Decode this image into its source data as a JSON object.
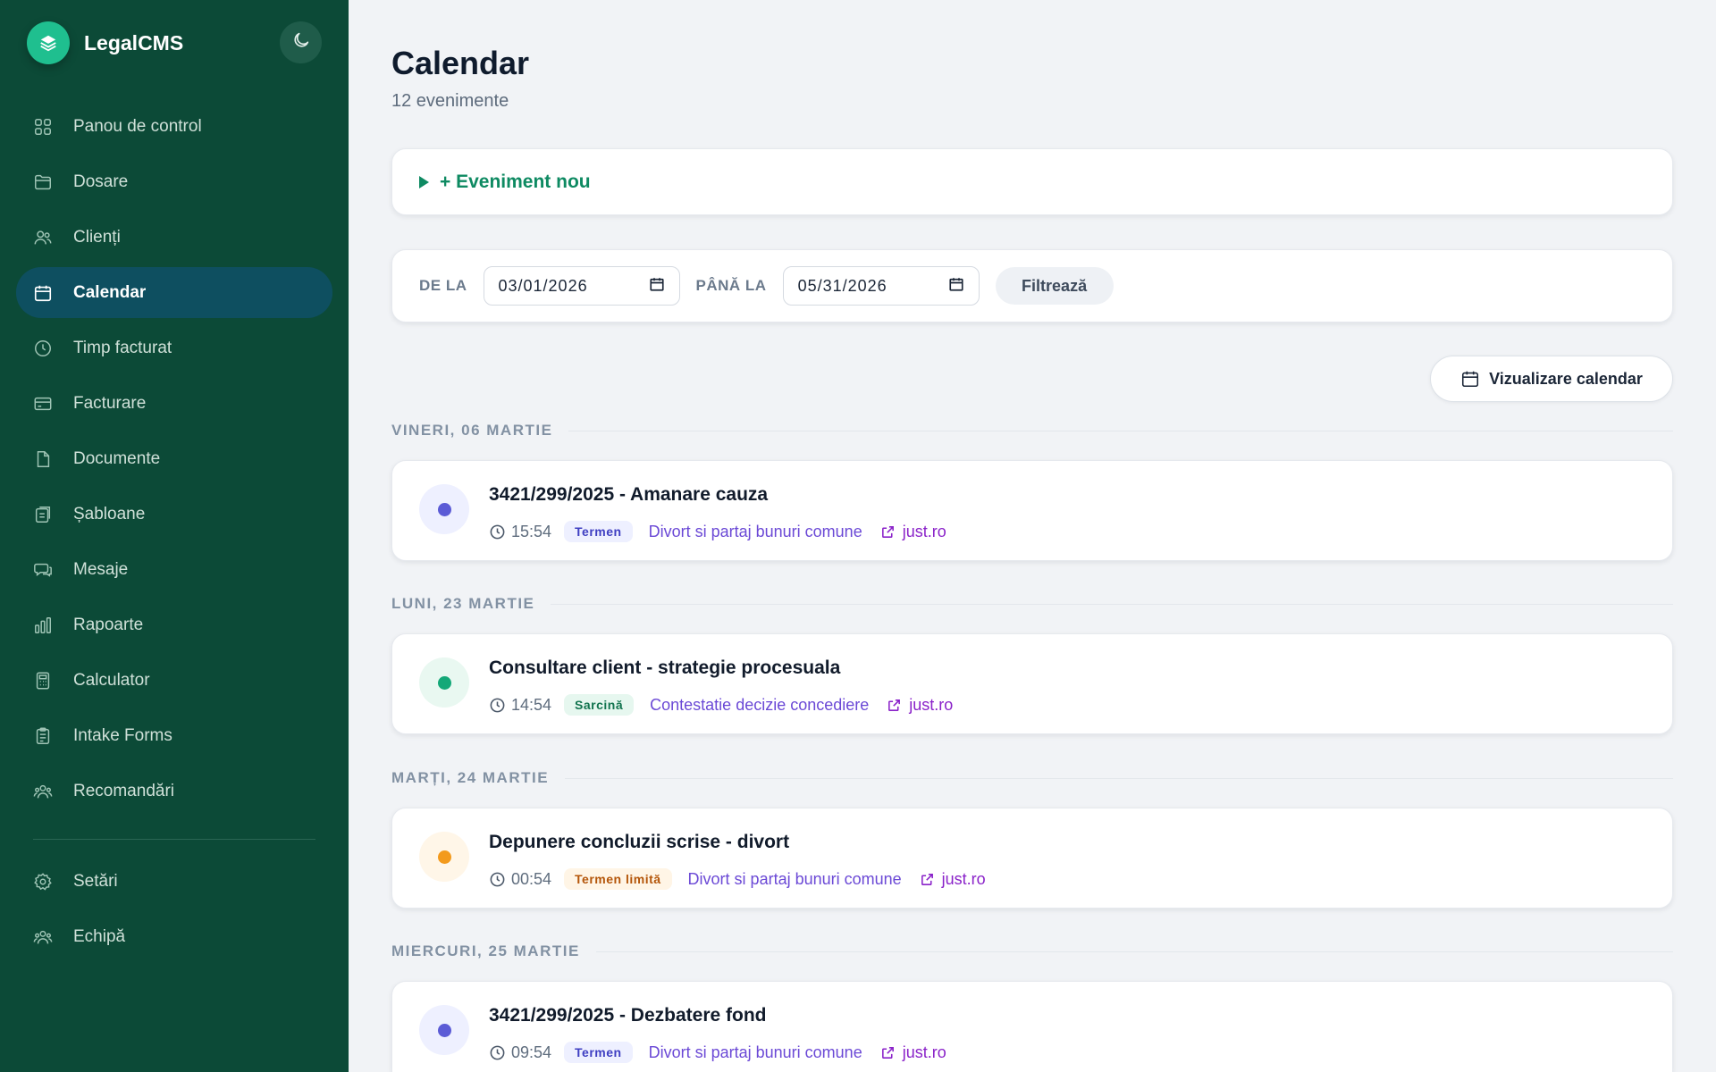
{
  "app": {
    "name": "LegalCMS"
  },
  "sidebar": {
    "items": [
      {
        "label": "Panou de control",
        "icon": "dashboard-icon"
      },
      {
        "label": "Dosare",
        "icon": "folder-icon"
      },
      {
        "label": "Clienți",
        "icon": "users-icon"
      },
      {
        "label": "Calendar",
        "icon": "calendar-icon",
        "active": true
      },
      {
        "label": "Timp facturat",
        "icon": "clock-icon"
      },
      {
        "label": "Facturare",
        "icon": "credit-card-icon"
      },
      {
        "label": "Documente",
        "icon": "document-icon"
      },
      {
        "label": "Șabloane",
        "icon": "templates-icon"
      },
      {
        "label": "Mesaje",
        "icon": "messages-icon"
      },
      {
        "label": "Rapoarte",
        "icon": "bar-chart-icon"
      },
      {
        "label": "Calculator",
        "icon": "calculator-icon"
      },
      {
        "label": "Intake Forms",
        "icon": "clipboard-icon"
      },
      {
        "label": "Recomandări",
        "icon": "referrals-icon"
      }
    ],
    "bottom_items": [
      {
        "label": "Setări",
        "icon": "gear-icon"
      },
      {
        "label": "Echipă",
        "icon": "team-icon"
      }
    ]
  },
  "page": {
    "title": "Calendar",
    "subtitle": "12 evenimente"
  },
  "new_event": {
    "label": "+ Eveniment nou"
  },
  "filter": {
    "from_label": "DE LA",
    "from_value": "03/01/2026",
    "to_label": "PÂNĂ LA",
    "to_value": "05/31/2026",
    "button": "Filtrează"
  },
  "view_toggle": {
    "label": "Vizualizare calendar"
  },
  "days": [
    {
      "label": "VINERI, 06 MARTIE",
      "events": [
        {
          "title": "3421/299/2025 - Amanare cauza",
          "time": "15:54",
          "type": "Termen",
          "case": "Divort si partaj bunuri comune",
          "link": "just.ro",
          "color": "#5b5bd6"
        }
      ]
    },
    {
      "label": "LUNI, 23 MARTIE",
      "events": [
        {
          "title": "Consultare client - strategie procesuala",
          "time": "14:54",
          "type": "Sarcină",
          "case": "Contestatie decizie concediere",
          "link": "just.ro",
          "color": "#14a878"
        }
      ]
    },
    {
      "label": "MARȚI, 24 MARTIE",
      "events": [
        {
          "title": "Depunere concluzii scrise - divort",
          "time": "00:54",
          "type": "Termen limită",
          "case": "Divort si partaj bunuri comune",
          "link": "just.ro",
          "color": "#f39a1c"
        }
      ]
    },
    {
      "label": "MIERCURI, 25 MARTIE",
      "events": [
        {
          "title": "3421/299/2025 - Dezbatere fond",
          "time": "09:54",
          "type": "Termen",
          "case": "Divort si partaj bunuri comune",
          "link": "just.ro",
          "color": "#5b5bd6"
        }
      ]
    }
  ]
}
